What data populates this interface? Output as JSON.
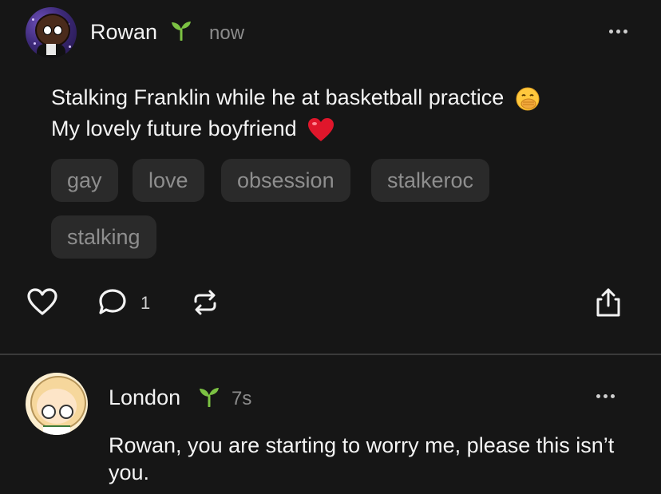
{
  "post": {
    "author": "Rowan",
    "time": "now",
    "text_line1": "Stalking Franklin while he at basketball practice",
    "text_line2": "My lovely future boyfriend",
    "tags": [
      "gay",
      "love",
      "obsession",
      "stalkeroc",
      "stalking"
    ],
    "comment_count": "1"
  },
  "reply": {
    "author": "London",
    "time": "7s",
    "text": "Rowan, you are starting to worry me, please this isn’t you."
  },
  "colors": {
    "background": "#161616",
    "sprout_green": "#7cc243",
    "tag_bg": "#2a2a2a",
    "heart_red": "#e0162b"
  },
  "icons": [
    "sprout-icon",
    "more-icon",
    "like-icon",
    "comment-icon",
    "repost-icon",
    "share-icon"
  ]
}
